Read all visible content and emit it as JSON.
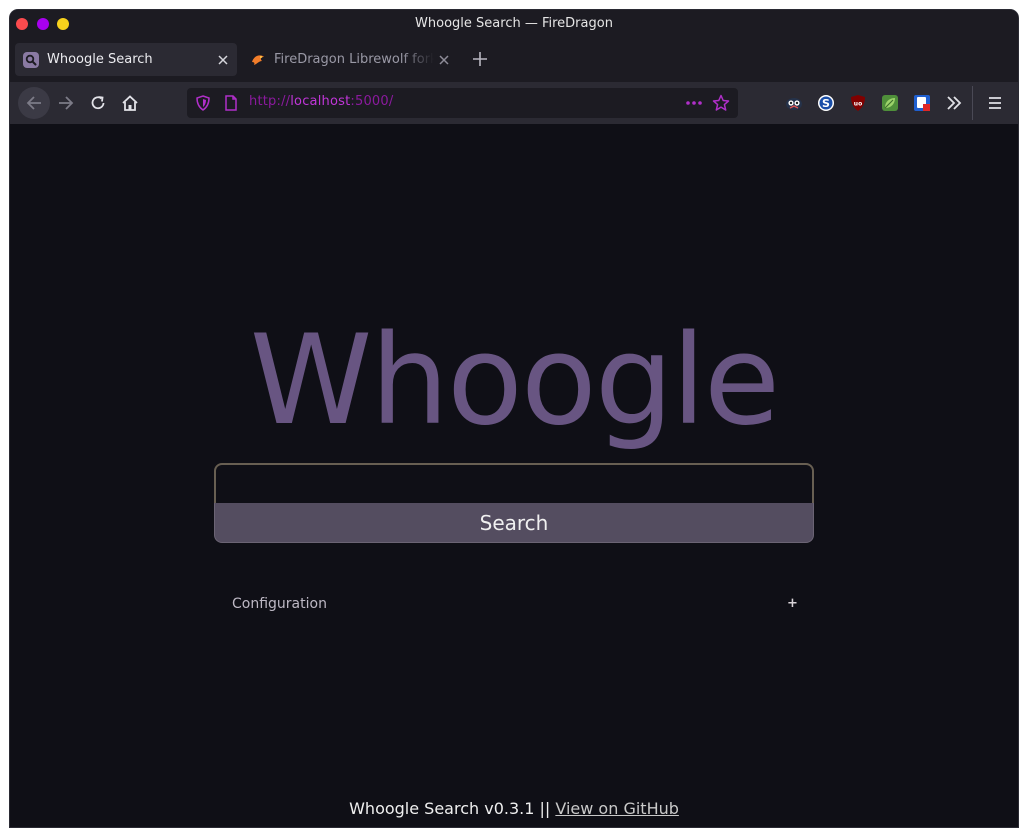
{
  "window": {
    "title": "Whoogle Search — FireDragon"
  },
  "tabs": [
    {
      "label": "Whoogle Search",
      "icon": "search-icon",
      "active": true
    },
    {
      "label": "FireDragon Librewolf fork",
      "icon": "firedragon-icon",
      "active": false
    }
  ],
  "nav": {
    "url_scheme": "http://",
    "url_host": "localhost",
    "url_port": ":5000/",
    "extensions": [
      "privacy-badger-icon",
      "s-extension-icon",
      "ublock-origin-icon",
      "leaf-extension-icon",
      "shield-extension-icon"
    ]
  },
  "page": {
    "logo": "Whoogle",
    "search_value": "",
    "search_button": "Search",
    "config_label": "Configuration",
    "config_toggle": "+",
    "footer_text": "Whoogle Search v0.3.1 || ",
    "footer_link": "View on GitHub"
  },
  "colors": {
    "background": "#0f0f16",
    "logo": "#685582",
    "search_button_bg": "#544d60",
    "url_host": "#c036d8",
    "accent": "#a800f0"
  }
}
